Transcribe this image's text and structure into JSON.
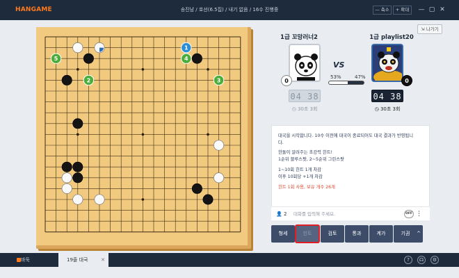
{
  "app": {
    "logo": "HANGAME",
    "window_title": "송진남 / 호선(6.5집) / 내기 없음 / 16수 진행중",
    "shrink_label": "— 축소",
    "expand_label": "+ 확대",
    "min_icon": "minimize-icon",
    "max_icon": "maximize-icon",
    "close_icon": "close-icon"
  },
  "header": {
    "new_game_label": "나가기"
  },
  "players": {
    "left": {
      "name": "1급 꼬망러너2",
      "stone_number": "0",
      "stone_color": "white",
      "timer": "04 38",
      "byoyomi": "30초 3회",
      "win_rate": "53%"
    },
    "right": {
      "name": "1급 playlist20",
      "stone_number": "0",
      "stone_color": "black",
      "timer": "04 38",
      "byoyomi": "30초 3회",
      "win_rate": "47%"
    },
    "vs_label": "VS"
  },
  "win_bar": {
    "left_fraction": 0.53
  },
  "board": {
    "size": 19,
    "stones": [
      {
        "col": 3,
        "row": 1,
        "color": "white"
      },
      {
        "col": 4,
        "row": 2,
        "color": "black"
      },
      {
        "col": 14,
        "row": 2,
        "color": "black"
      },
      {
        "col": 2,
        "row": 4,
        "color": "black"
      },
      {
        "col": 3,
        "row": 8,
        "color": "black"
      },
      {
        "col": 16,
        "row": 10,
        "color": "white"
      },
      {
        "col": 2,
        "row": 12,
        "color": "black"
      },
      {
        "col": 3,
        "row": 12,
        "color": "black"
      },
      {
        "col": 2,
        "row": 13,
        "color": "white"
      },
      {
        "col": 3,
        "row": 13,
        "color": "black"
      },
      {
        "col": 16,
        "row": 13,
        "color": "white"
      },
      {
        "col": 2,
        "row": 14,
        "color": "white"
      },
      {
        "col": 14,
        "row": 14,
        "color": "black"
      },
      {
        "col": 3,
        "row": 15,
        "color": "white"
      },
      {
        "col": 5,
        "row": 15,
        "color": "white"
      },
      {
        "col": 15,
        "row": 15,
        "color": "black"
      }
    ],
    "last_move": {
      "col": 5,
      "row": 1,
      "color": "white"
    },
    "markers": [
      {
        "col": 13,
        "row": 1,
        "label": "1",
        "color": "#2a8fd6"
      },
      {
        "col": 4,
        "row": 4,
        "label": "2",
        "color": "#4cae3a"
      },
      {
        "col": 16,
        "row": 4,
        "label": "3",
        "color": "#4cae3a"
      },
      {
        "col": 13,
        "row": 2,
        "label": "4",
        "color": "#4cae3a"
      },
      {
        "col": 1,
        "row": 2,
        "label": "5",
        "color": "#4cae3a"
      }
    ],
    "star_points": [
      [
        3,
        3
      ],
      [
        9,
        3
      ],
      [
        15,
        3
      ],
      [
        3,
        9
      ],
      [
        9,
        9
      ],
      [
        15,
        9
      ],
      [
        3,
        15
      ],
      [
        9,
        15
      ],
      [
        15,
        15
      ]
    ]
  },
  "chat": {
    "lines": [
      {
        "text": "대국을 시작합니다. 10수 이전에 대국이 종료되어도 대국 결과가 반영됩니",
        "red": false
      },
      {
        "text": "다.",
        "red": false
      },
      {
        "text": "한돌이 알려주는 초강력 힌트!",
        "red": false
      },
      {
        "text": "1순위 블루스팟, 2~5순위 그린스팟",
        "red": false
      },
      {
        "text": "1~10회 힌트 1개 차감",
        "red": false
      },
      {
        "text": "이후 10회당 +1개 차감",
        "red": false
      },
      {
        "text": "힌트 1회 사용, 보유 개수 26개",
        "red": true
      }
    ],
    "user_count": "2",
    "input_placeholder": "대화를 입력해 주세요.",
    "toggle_label": "OFF"
  },
  "actions": [
    "형세",
    "힌트",
    "검토",
    "통과",
    "계가",
    "기권",
    "^"
  ],
  "tabs": {
    "lobby": "바둑",
    "game": "19줄 대국",
    "game_close": "✕"
  },
  "colors": {
    "accent": "#ff7a1a",
    "titlebar": "#1e2b3d",
    "button": "#3c4c69",
    "highlight": "#e11e26",
    "board": "#f1c97f"
  }
}
